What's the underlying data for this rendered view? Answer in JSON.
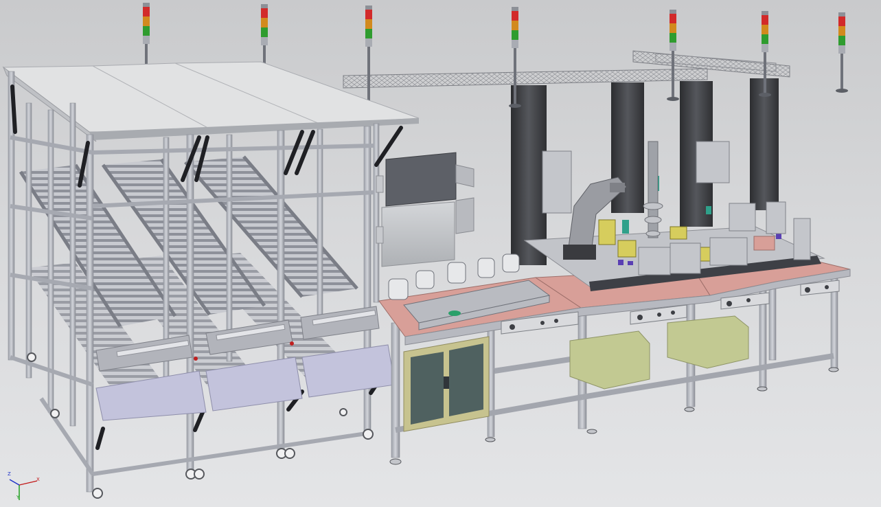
{
  "viewport": {
    "background_top": "#c9cacc",
    "background_bottom": "#e4e5e7"
  },
  "colors": {
    "frame_aluminum": "#b9bcc4",
    "frame_dark": "#6f737d",
    "roller": "#9fa2ab",
    "conveyor_belt": "#c3c3dc",
    "table_top": "#d89f98",
    "cabinet_panel": "#c7c38f",
    "cabinet_glass": "#4f6160",
    "enclosure_box": "#c2c992",
    "column_dark": "#3c3d40",
    "robot_arm": "#9a9ca2",
    "stack_light_red": "#d22a2a",
    "stack_light_amber": "#d28a1e",
    "stack_light_green": "#2f9c2f",
    "hmi_panel_dark": "#5d6067",
    "hmi_panel_light": "#c6c8cb"
  },
  "scene": {
    "stack_light_count": 7,
    "roller_conveyor_lanes": 3,
    "workbench_modules": 3,
    "gantry_columns": 4
  },
  "triad": {
    "x_label": "X",
    "y_label": "Y",
    "z_label": "Z",
    "x_color": "#c21818",
    "y_color": "#119b11",
    "z_color": "#1b2fc8"
  }
}
